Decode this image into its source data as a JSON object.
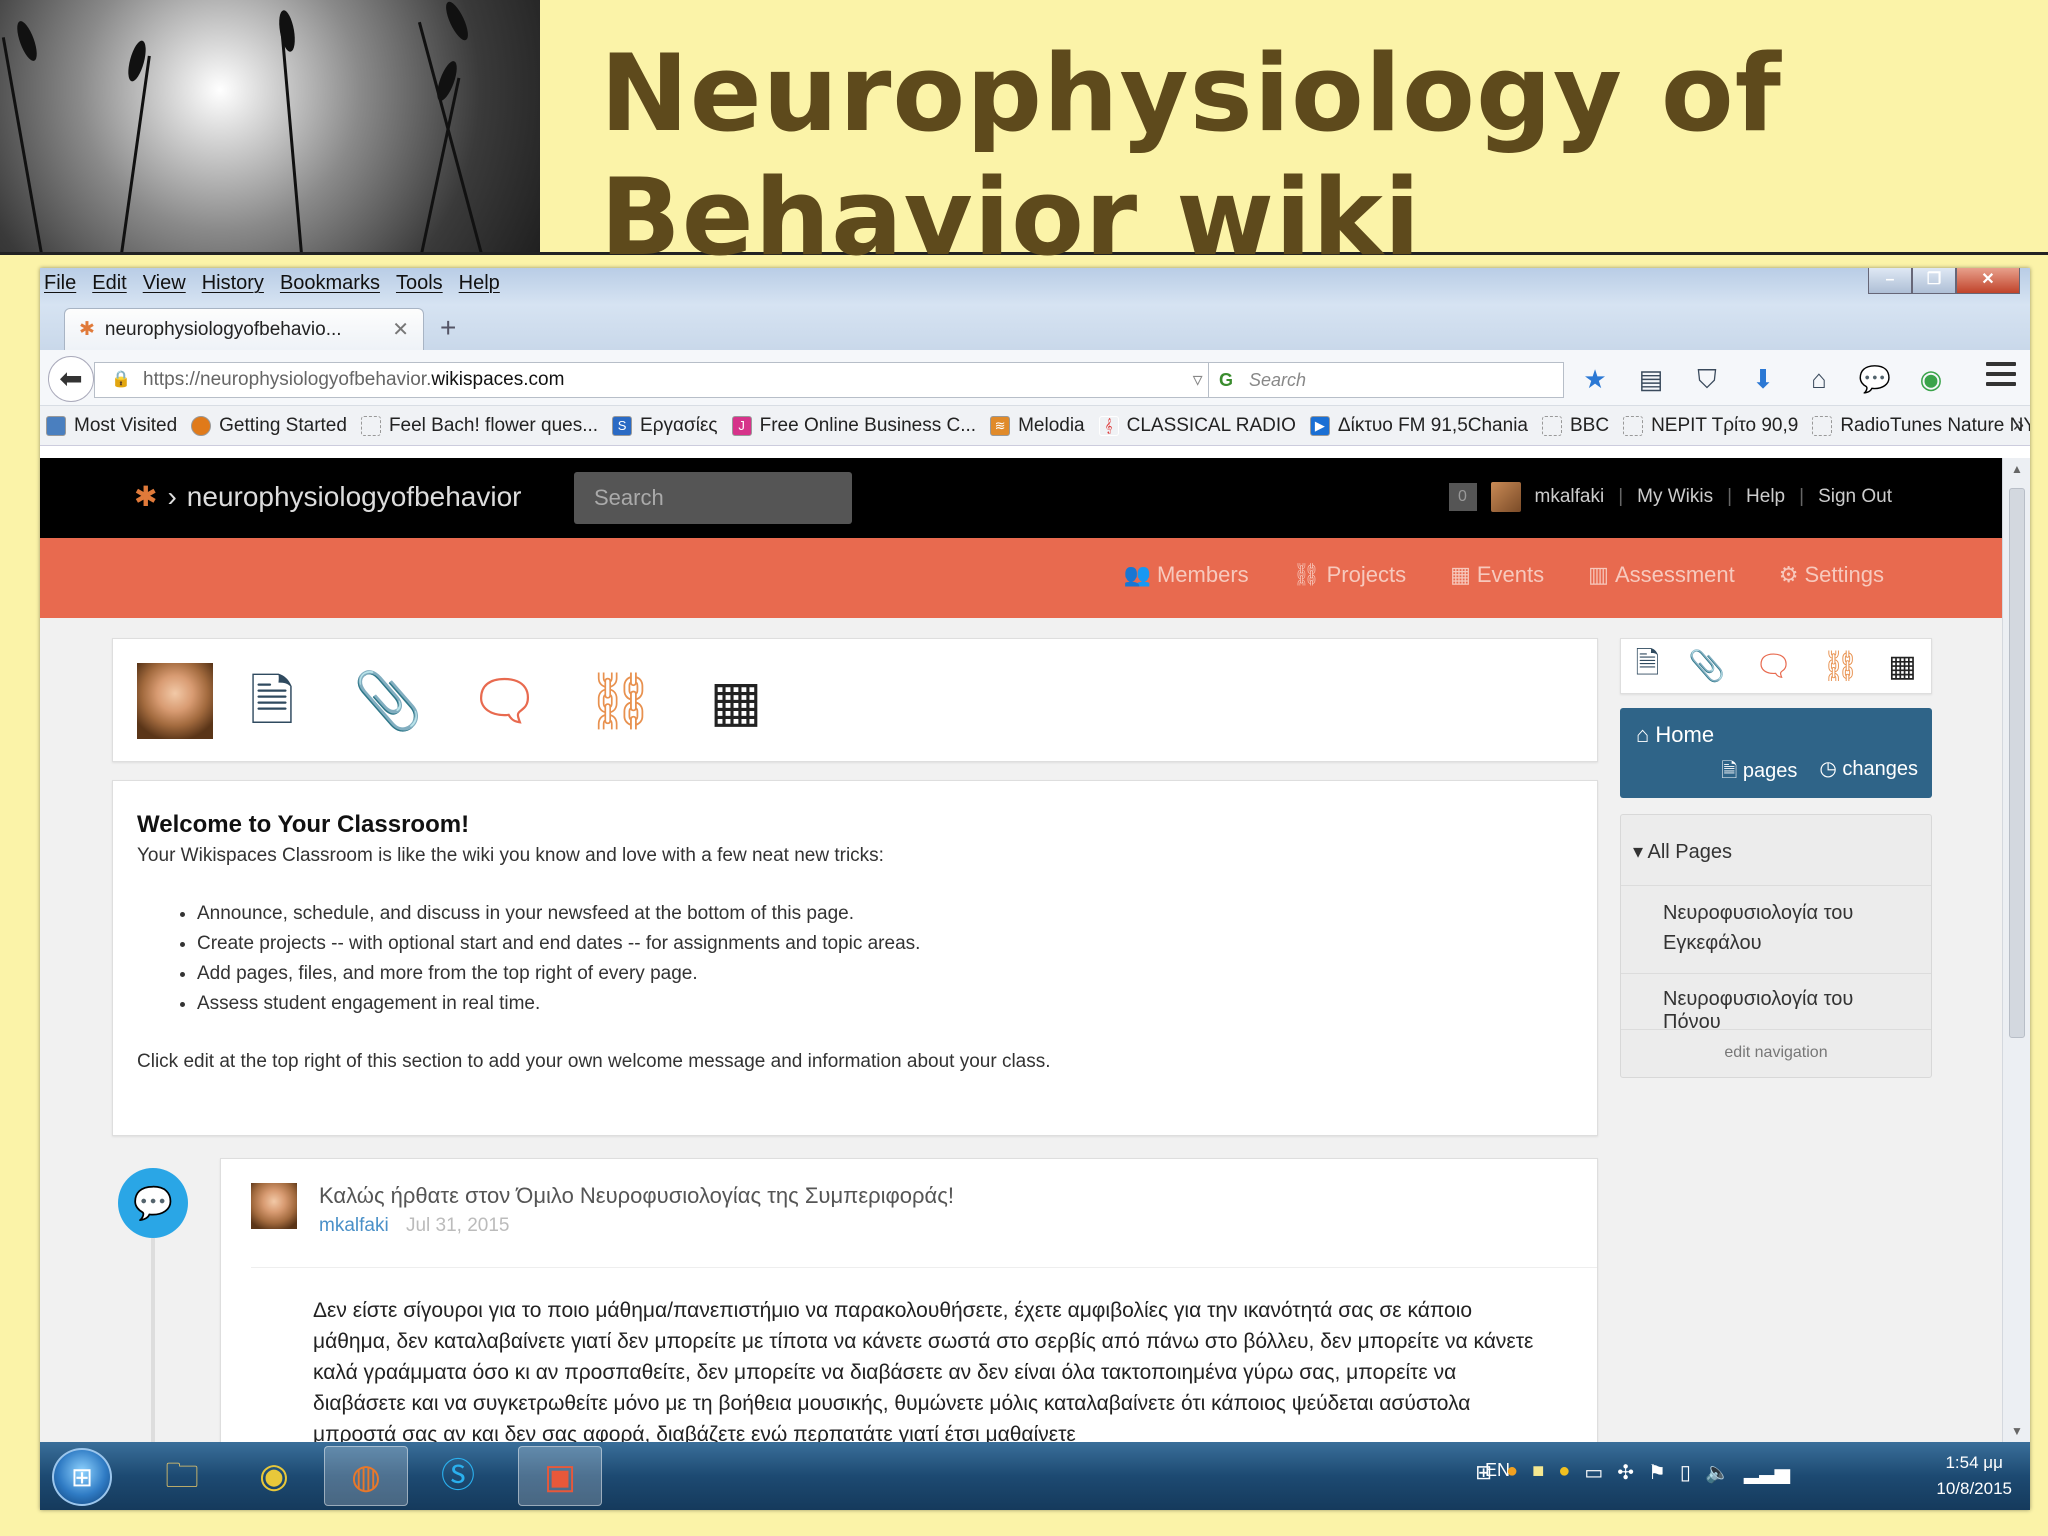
{
  "slide": {
    "title_line1": "Neurophysiology of",
    "title_line2": "Behavior wiki"
  },
  "browser": {
    "menu": [
      "File",
      "Edit",
      "View",
      "History",
      "Bookmarks",
      "Tools",
      "Help"
    ],
    "tab_title": "neurophysiologyofbehavio...",
    "url_prefix": "https://neurophysiologyofbehavior.",
    "url_domain": "wikispaces.com",
    "search_placeholder": "Search",
    "bookmarks": [
      "Most Visited",
      "Getting Started",
      "Feel Bach! flower ques...",
      "Εργασίες",
      "Free Online Business C...",
      "Melodia",
      "CLASSICAL RADIO",
      "Δίκτυο FM 91,5Chania",
      "BBC",
      "ΝΕΡΙΤ Τρίτο 90,9",
      "RadioTunes Nature NY"
    ]
  },
  "wikispaces": {
    "site_name": "neurophysiologyofbehavior",
    "search_placeholder": "Search",
    "notif_count": "0",
    "user": "mkalfaki",
    "my_wikis": "My Wikis",
    "help": "Help",
    "sign_out": "Sign Out",
    "nav": [
      "Members",
      "Projects",
      "Events",
      "Assessment",
      "Settings"
    ]
  },
  "welcome": {
    "heading": "Welcome to Your Classroom!",
    "intro": "Your Wikispaces Classroom is like the wiki you know and love with a few neat new tricks:",
    "bullets": [
      "Announce, schedule, and discuss in your newsfeed at the bottom of this page.",
      "Create projects -- with optional start and end dates -- for assignments and topic areas.",
      "Add pages, files, and more from the top right of every page.",
      "Assess student engagement in real time."
    ],
    "footer": "Click edit at the top right of this section to add your own welcome message and information about your class."
  },
  "post": {
    "title": "Καλώς ήρθατε στον Όμιλο Νευροφυσιολογίας της Συμπεριφοράς!",
    "author": "mkalfaki",
    "date": "Jul 31, 2015",
    "body": "Δεν είστε σίγουροι για το ποιο μάθημα/πανεπιστήμιο να παρακολουθήσετε, έχετε αμφιβολίες για την ικανότητά σας σε κάποιο μάθημα, δεν καταλαβαίνετε γιατί δεν μπορείτε με τίποτα να κάνετε σωστά στο σερβίς από πάνω στο βόλλευ, δεν μπορείτε να κάνετε καλά γραάμματα όσο κι αν προσπαθείτε, δεν μπορείτε να διαβάσετε αν δεν είναι όλα τακτοποιημένα γύρω σας, μπορείτε να διαβάσετε και να συγκετρωθείτε μόνο με τη βοήθεια μουσικής, θυμώνετε μόλις καταλαβαίνετε ότι κάποιος ψεύδεται ασύστολα μπροστά σας αν και δεν σας αφορά, διαβάζετε ενώ περπατάτε γιατί έτσι μαθαίνετε"
  },
  "sidebar": {
    "home": "Home",
    "pages": "pages",
    "changes": "changes",
    "all_pages": "All Pages",
    "page1": "Νευροφυσιολογία του Εγκεφάλου",
    "page2": "Νευροφυσιολογία του Πόνου",
    "edit_nav": "edit navigation"
  },
  "taskbar": {
    "lang": "EN",
    "time": "1:54 μμ",
    "date": "10/8/2015"
  },
  "colors": {
    "slide_bg": "#fbf3a8",
    "title": "#5e4a1c",
    "orange_nav": "#e86a4f",
    "home_box": "#2f6488"
  }
}
